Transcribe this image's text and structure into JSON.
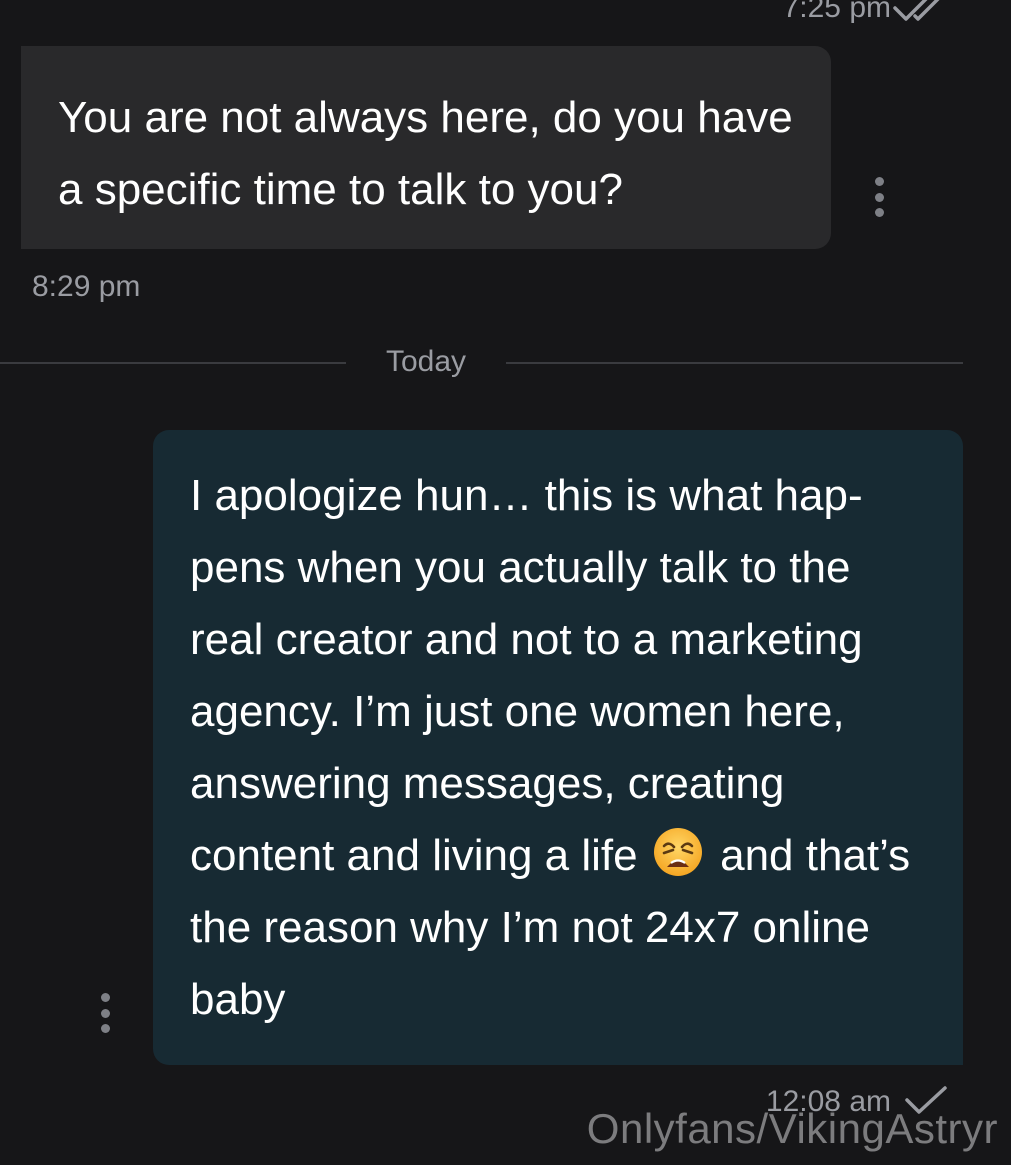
{
  "chat": {
    "prev_message": {
      "time": "7:25 pm",
      "status_icon": "double-check-icon"
    },
    "incoming_message": {
      "text": "You are not always here, do you have a specific time to talk to you?",
      "time": "8:29 pm",
      "menu_icon": "more-vertical-icon"
    },
    "date_divider": {
      "label": "Today"
    },
    "outgoing_message": {
      "text_before_emoji": "I apologize hun… this is what hap- pens when you actually talk to the real creator and not to a marketing agency. I’m just one women here, answering messages, creating content and living a life",
      "emoji": "weary-face-emoji",
      "text_after_emoji": "and that’s the reason why I’m not 24x7 online baby",
      "time": "12:08 am",
      "status_icon": "single-check-icon",
      "menu_icon": "more-vertical-icon"
    }
  },
  "watermark": {
    "text": "Onlyfans/VikingAstryr"
  },
  "colors": {
    "background": "#161618",
    "incoming_bubble": "#29292b",
    "outgoing_bubble": "#172a33",
    "meta_text": "#9a9ca2",
    "message_text": "#ffffff"
  }
}
